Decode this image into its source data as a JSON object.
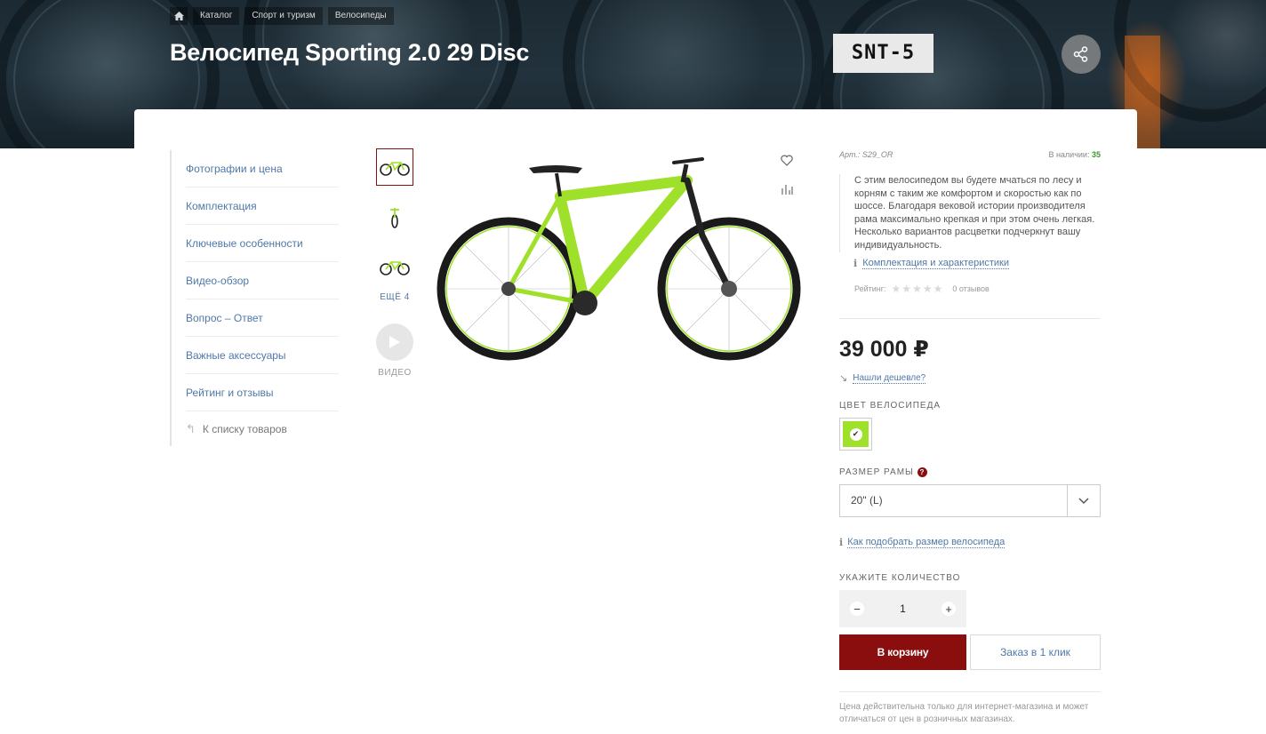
{
  "breadcrumb": [
    "Каталог",
    "Спорт и туризм",
    "Велосипеды"
  ],
  "product": {
    "title": "Велосипед Sporting 2.0 29 Disc",
    "brand": "SNT-5",
    "article": "Арт.: S29_OR",
    "stock_label": "В наличии:",
    "stock_count": "35",
    "description": "С этим велосипедом вы будете мчаться по лесу и корням с таким же комфортом и скоростью как по шоссе. Благодаря вековой истории производителя рама максимально крепкая и при этом очень легкая. Несколько вариантов расцветки подчеркнут вашу индивидуальность.",
    "spec_link": "Комплектация и характеристики",
    "rating_label": "Рейтинг:",
    "reviews": "0 отзывов",
    "price": "39 000 ₽",
    "cheaper_link": "Нашли дешевле?",
    "color_label": "ЦВЕТ ВЕЛОСИПЕДА",
    "color_value": "#9fe02a",
    "size_label": "РАЗМЕР РАМЫ",
    "size_selected": "20\" (L)",
    "size_link": "Как подобрать размер велосипеда",
    "qty_label": "УКАЖИТЕ КОЛИЧЕСТВО",
    "qty": "1",
    "cart_button": "В корзину",
    "oneclick_button": "Заказ в 1 клик",
    "note": "Цена действительна только для интернет-магазина и может отличаться от цен в розничных магазинах."
  },
  "sidenav": {
    "items": [
      "Фотографии и цена",
      "Комплектация",
      "Ключевые особенности",
      "Видео-обзор",
      "Вопрос – Ответ",
      "Важные аксессуары",
      "Рейтинг и отзывы"
    ],
    "back": "К списку товаров"
  },
  "gallery": {
    "more": "ЕЩЁ 4",
    "video": "ВИДЕО"
  },
  "colors": {
    "accent": "#8b0e0e",
    "link": "#4f78a8",
    "bike": "#9fe02a"
  }
}
